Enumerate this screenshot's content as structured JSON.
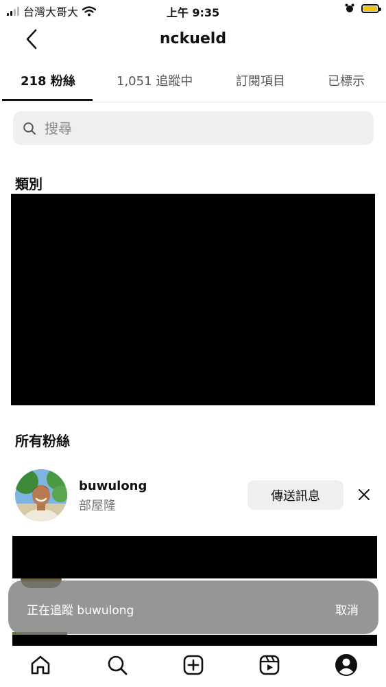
{
  "status_bar": {
    "carrier": "台灣大哥大",
    "time": "上午 9:35"
  },
  "header": {
    "title": "nckueld"
  },
  "tabs": [
    {
      "label": "218 粉絲",
      "active": true
    },
    {
      "label": "1,051 追蹤中",
      "active": false
    },
    {
      "label": "訂閱項目",
      "active": false
    },
    {
      "label": "已標示",
      "active": false
    }
  ],
  "search": {
    "placeholder": "搜尋"
  },
  "sections": {
    "categories": "類別",
    "all_followers": "所有粉絲"
  },
  "followers": [
    {
      "username": "buwulong",
      "full_name": "部屋隆",
      "action_label": "傳送訊息"
    }
  ],
  "toast": {
    "message": "正在追蹤 buwulong",
    "action": "取消"
  },
  "bottom_nav": [
    "home-icon",
    "search-icon",
    "create-icon",
    "reels-icon",
    "profile-icon"
  ],
  "colors": {
    "battery": "#f5c400",
    "search_bg": "#efefef"
  }
}
